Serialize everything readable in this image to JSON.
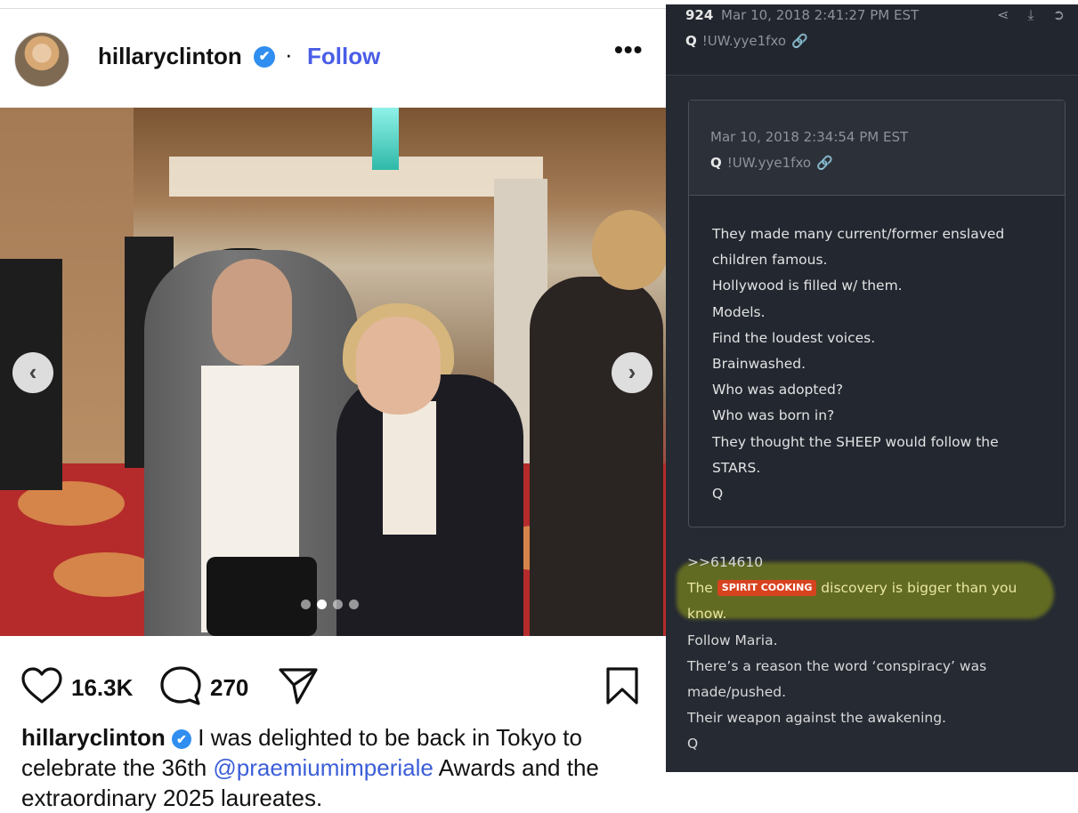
{
  "instagram": {
    "username": "hillaryclinton",
    "verified_symbol": "✔",
    "separator": "·",
    "follow_label": "Follow",
    "more_label": "•••",
    "carousel": {
      "prev": "‹",
      "next": "›",
      "slide_count": 4,
      "active_slide": 2
    },
    "likes": "16.3K",
    "comments": "270",
    "caption": {
      "username": "hillaryclinton",
      "text_before": " I was delighted to be back in Tokyo to celebrate the 36th ",
      "mention": "@praemiumimperiale",
      "text_after": " Awards and the extraordinary 2025 laureates."
    },
    "icons": [
      "heart-icon",
      "comment-icon",
      "share-icon",
      "bookmark-icon",
      "verified-icon"
    ]
  },
  "qpost": {
    "number": "924",
    "date": "Mar 10, 2018 2:41:27 PM EST",
    "author_q": "Q",
    "tripcode": "!UW.yye1fxo",
    "top_icons": "⋖ ⤓ ➲",
    "link_icon": "🔗",
    "quote": {
      "date": "Mar 10, 2018 2:34:54 PM EST",
      "author_q": "Q",
      "tripcode": "!UW.yye1fxo",
      "lines": [
        "They made many current/former enslaved",
        "children famous.",
        "Hollywood is filled w/ them.",
        "Models.",
        "Find the loudest voices.",
        "Brainwashed.",
        "Who was adopted?",
        "Who was born in?",
        "They thought the SHEEP would follow the",
        "STARS.",
        "Q"
      ]
    },
    "reply": {
      "ref": ">>614610",
      "hl_before": "The ",
      "tag": "SPIRIT COOKING",
      "hl_after": " discovery is bigger than you",
      "hl_cont": "know.",
      "lines": [
        "Follow Maria.",
        "There’s a reason the word ‘conspiracy’ was",
        "made/pushed.",
        "Their weapon against the awakening.",
        "Q"
      ]
    },
    "colors": {
      "background": "#252a33",
      "highlight": "#8f9a14",
      "tag": "#d8431f",
      "link": "#3a8cf0"
    }
  }
}
